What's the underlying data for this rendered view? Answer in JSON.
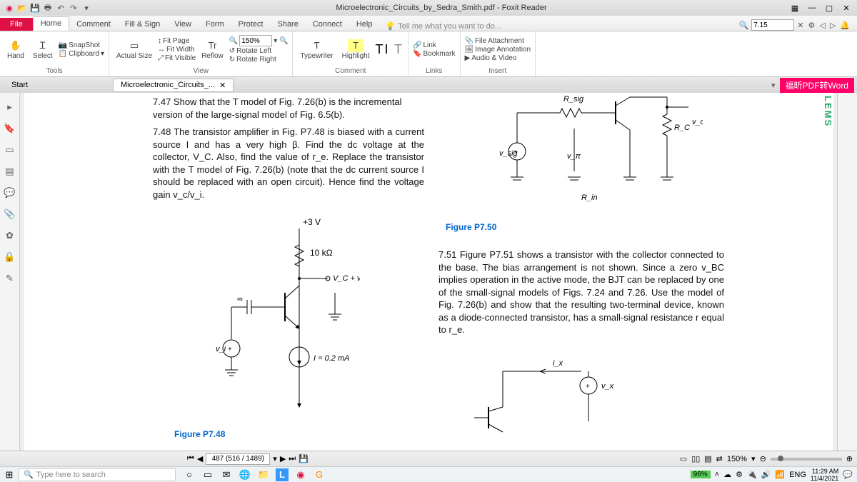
{
  "window": {
    "title": "Microelectronic_Circuits_by_Sedra_Smith.pdf - Foxit Reader"
  },
  "ribbon_tabs": [
    "Home",
    "Comment",
    "Fill & Sign",
    "View",
    "Form",
    "Protect",
    "Share",
    "Connect",
    "Help"
  ],
  "file_tab": "File",
  "tellme": "Tell me what you want to do...",
  "find_value": "7.15",
  "ribbon": {
    "tools": {
      "hand": "Hand",
      "select": "Select",
      "snapshot": "SnapShot",
      "clipboard": "Clipboard",
      "label": "Tools"
    },
    "view": {
      "actual": "Actual Size",
      "fitpage": "Fit Page",
      "fitwidth": "Fit Width",
      "fitvisible": "Fit Visible",
      "reflow": "Reflow",
      "zoom": "150%",
      "rotL": "Rotate Left",
      "rotR": "Rotate Right",
      "label": "View"
    },
    "comment": {
      "typewriter": "Typewriter",
      "highlight": "Highlight",
      "TI": "TI",
      "T": "T",
      "label": "Comment"
    },
    "links": {
      "link": "Link",
      "bookmark": "Bookmark",
      "label": "Links"
    },
    "insert": {
      "fileatt": "File Attachment",
      "imgann": "Image Annotation",
      "av": "Audio & Video",
      "label": "Insert"
    }
  },
  "doctabs": {
    "start": "Start",
    "tab": "Microelectronic_Circuits_...",
    "badge": "福昕PDF转Word"
  },
  "lems": "LEMS",
  "content": {
    "p747": "7.47 Show that the T model of Fig. 7.26(b) is the incremental version of the large-signal model of Fig. 6.5(b).",
    "p748": "7.48 The transistor amplifier in Fig. P7.48 is biased with a current source I and has a very high β. Find the dc voltage at the collector, V_C. Also, find the value of r_e. Replace the transistor with the T model of Fig. 7.26(b) (note that the dc current source I should be replaced with an open circuit). Hence find the voltage gain v_c/v_i.",
    "p750label": "Figure P7.50",
    "p748label": "Figure P7.48",
    "p751": "7.51 Figure P7.51 shows a transistor with the collector connected to the base. The bias arrangement is not shown. Since a zero v_BC implies operation in the active mode, the BJT can be replaced by one of the small-signal models of Figs. 7.24 and 7.26. Use the model of Fig. 7.26(b) and show that the resulting two-terminal device, known as a diode-connected transistor, has a small-signal resistance r equal to r_e.",
    "ckt": {
      "plus3v": "+3 V",
      "r10k": "10 kΩ",
      "vc": "V_C + v_c",
      "i02": "I = 0.2 mA",
      "vi": "v_i",
      "inf": "∞"
    },
    "top": {
      "rsig": "R_sig",
      "vsig": "v_sig",
      "rc": "R_C",
      "vo": "v_o",
      "vpi": "v_π",
      "rin": "R_in"
    },
    "p751ckt": {
      "ix": "i_x",
      "vx": "v_x"
    }
  },
  "status": {
    "page": "487 (516 / 1489)",
    "zoom": "150%"
  },
  "taskbar": {
    "search": "Type here to search",
    "battery": "96%",
    "lang": "ENG",
    "time": "11:29 AM",
    "date": "11/4/2021"
  }
}
